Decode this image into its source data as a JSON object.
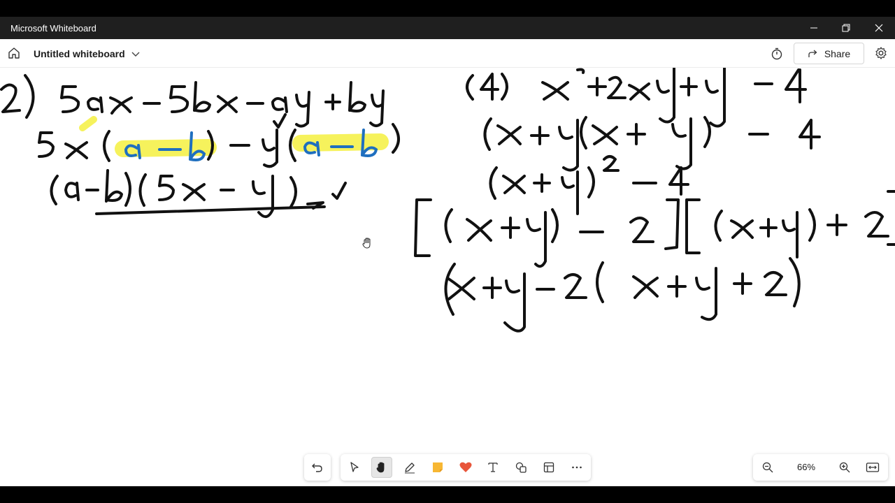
{
  "window": {
    "app_title": "Microsoft Whiteboard"
  },
  "header": {
    "board_title": "Untitled whiteboard",
    "share_label": "Share"
  },
  "toolbar": {
    "tools": [
      "undo-icon",
      "select-icon",
      "hand-pan-icon",
      "pen-icon",
      "sticky-note-icon",
      "reactions-icon",
      "text-icon",
      "shapes-icon",
      "templates-icon",
      "more-icon"
    ],
    "active_tool": "hand-pan-icon"
  },
  "zoom": {
    "level": "66%"
  },
  "colors": {
    "titlebar": "#1f1f1f",
    "ink": "#111111",
    "ink_blue": "#1f6fbf",
    "highlighter": "#f5f040",
    "sticky": "#f7b733",
    "heart": "#e8553a"
  }
}
